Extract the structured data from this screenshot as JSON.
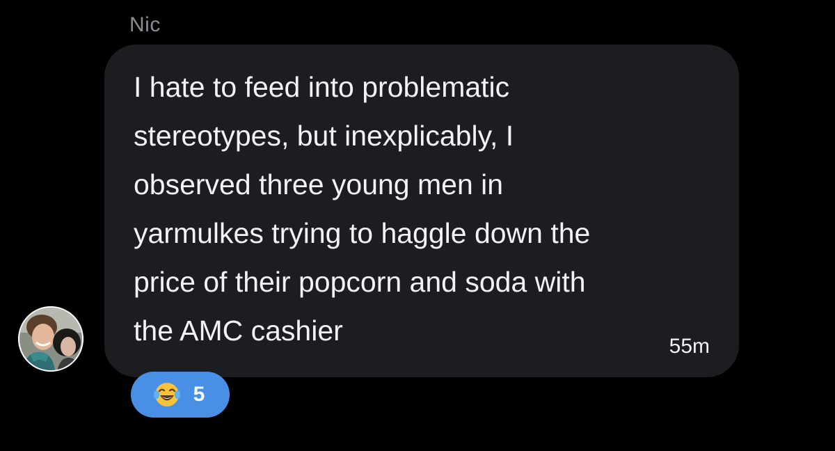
{
  "conversation": {
    "sender_name": "Nic",
    "message": {
      "text": "I hate to feed into problematic\nstereotypes, but inexplicably, I\nobserved three young men in\nyarmulkes trying to haggle down the\nprice of their popcorn and soda with\nthe AMC cashier",
      "timestamp": "55m"
    },
    "avatar": {
      "icon": "user-avatar"
    },
    "reaction": {
      "emoji_icon": "face-with-tears-of-joy-icon",
      "count": "5"
    }
  },
  "colors": {
    "background": "#000000",
    "bubble": "#1c1d20",
    "text": "#f2f3f5",
    "name": "#8b8f94",
    "reaction_pill": "#4a8fe6"
  }
}
